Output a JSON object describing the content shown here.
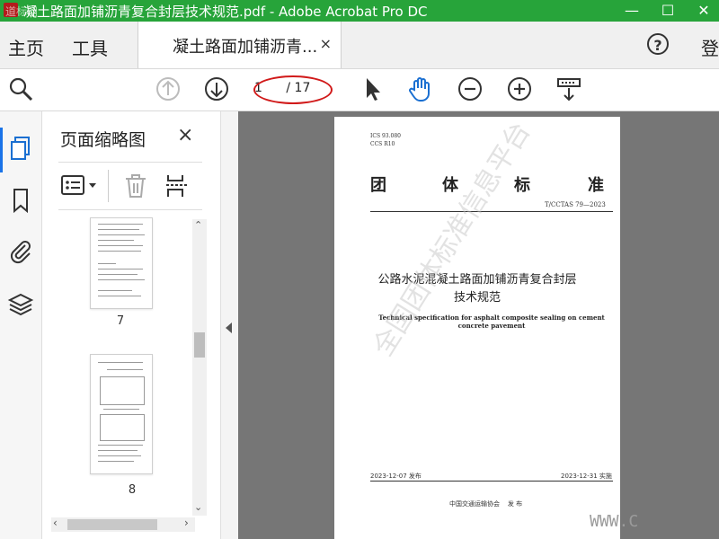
{
  "window": {
    "title": "凝土路面加铺沥青复合封层技术规范.pdf - Adobe Acrobat Pro DC",
    "minimize": "—",
    "maximize": "☐",
    "close": "✕"
  },
  "menubar": {
    "home": "主页",
    "tools": "工具",
    "doc_tab_label": "凝土路面加铺沥青...",
    "doc_tab_close": "×",
    "help": "?",
    "signin": "登"
  },
  "toolbar": {
    "page_current": "1",
    "page_total": "/ 17",
    "icons": [
      "search-zoom-icon",
      "prev-page-icon",
      "next-page-icon",
      "select-cursor-icon",
      "hand-tool-icon",
      "zoom-out-icon",
      "zoom-in-icon",
      "scroll-mode-icon"
    ]
  },
  "left_rail": {
    "icons": [
      "page-thumbnails-icon",
      "bookmark-icon",
      "attachment-icon",
      "layers-icon"
    ]
  },
  "thumb_panel": {
    "title": "页面缩略图",
    "close": "×",
    "pages": [
      {
        "label": "7"
      },
      {
        "label": "8"
      }
    ]
  },
  "document": {
    "ics": "ICS 93.080",
    "ccs": "CCS R10",
    "heading_chars": [
      "团",
      "体",
      "标",
      "准"
    ],
    "code": "T/CCTAS 79—2023",
    "title_line1": "公路水泥混凝土路面加铺沥青复合封层",
    "title_line2": "技术规范",
    "en_title_line1": "Technical specification for asphalt composite sealing on cement",
    "en_title_line2": "concrete pavement",
    "issue_date": "2023-12-07 发布",
    "impl_date": "2023-12-31 实施",
    "publisher": "中国交通运输协会    发 布",
    "watermark": "全国团体标准信息平台"
  },
  "overlay": {
    "site_watermark": "WWW.C",
    "corner_watermark": "道标网"
  },
  "colors": {
    "titlebar": "#27a43a",
    "frame": "#f3e11e",
    "annotation_oval": "#d11a1a",
    "accent": "#1a73e8"
  }
}
